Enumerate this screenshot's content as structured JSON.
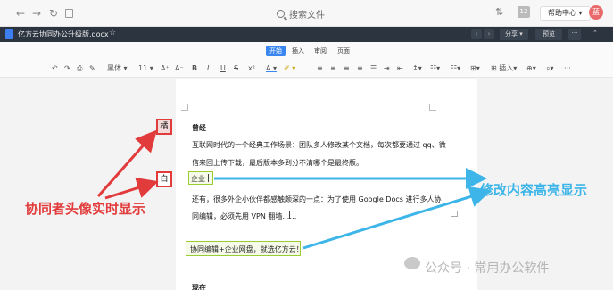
{
  "browser": {
    "search_placeholder": "搜索文件",
    "badge": "12",
    "help_label": "帮助中心",
    "avatar_initial": "蓝"
  },
  "doc": {
    "title": "亿方云协同办公升级版.docx",
    "share_label": "分享",
    "preview_label": "预览",
    "more_label": "···"
  },
  "tabs": [
    "开始",
    "插入",
    "审阅",
    "页面"
  ],
  "toolbar": {
    "font": "黑体",
    "size": "11",
    "insert_label": "插入"
  },
  "content": {
    "heading1": "曾经",
    "para1_line1": "互联网时代的一个经典工作场景：团队多人修改某个文档，每次都要通过 qq、微",
    "para1_line2": "信来回上传下载，最后版本多到分不清哪个是最终版。",
    "highlight1": "企业",
    "para2_line1": "还有，很多外企小伙伴都感触颇深的一点：为了使用 Google Docs 进行多人协",
    "para2_line2": "同编辑，必须先用 VPN 翻墙……",
    "highlight2": "协同编辑+企业网盘，就选亿方云！",
    "heading2": "现在"
  },
  "collaborators": {
    "avatar1": "橘",
    "avatar2": "白"
  },
  "annotations": {
    "left_label": "协同者头像实时显示",
    "right_label": "修改内容高亮显示"
  },
  "watermark": "公众号 · 常用办公软件",
  "colors": {
    "annotation_red": "#e23b3b",
    "annotation_blue": "#3db5e8",
    "highlight_border": "#9acd32",
    "accent": "#3a86f0"
  }
}
